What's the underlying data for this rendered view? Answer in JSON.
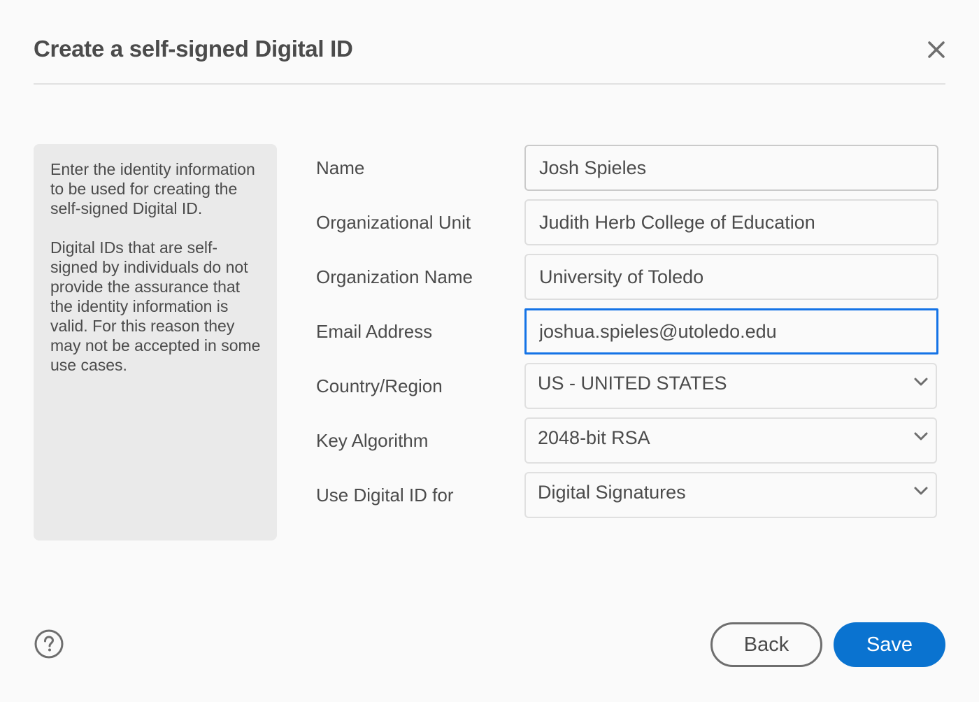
{
  "dialog": {
    "title": "Create a self-signed Digital ID",
    "close_icon": "close-icon"
  },
  "info_panel": {
    "paragraphs": [
      "Enter the identity information to be used for creating the self-signed Digital ID.",
      "Digital IDs that are self-signed by individuals do not provide the assurance that the identity information is valid. For this reason they may not be accepted in some use cases."
    ]
  },
  "form": {
    "name": {
      "label": "Name",
      "value": "Josh Spieles"
    },
    "org_unit": {
      "label": "Organizational Unit",
      "value": "Judith Herb College of Education"
    },
    "org_name": {
      "label": "Organization Name",
      "value": "University of Toledo"
    },
    "email": {
      "label": "Email Address",
      "value": "joshua.spieles@utoledo.edu",
      "focused": true
    },
    "country": {
      "label": "Country/Region",
      "selected": "US - UNITED STATES"
    },
    "key_algorithm": {
      "label": "Key Algorithm",
      "selected": "2048-bit RSA"
    },
    "use_for": {
      "label": "Use Digital ID for",
      "selected": "Digital Signatures"
    }
  },
  "footer": {
    "help_icon": "help-circle-icon",
    "back_label": "Back",
    "save_label": "Save"
  },
  "colors": {
    "accent": "#0a73d0",
    "focus_border": "#1473e6",
    "text": "#4b4b4b",
    "panel_bg": "#eaeaea"
  }
}
